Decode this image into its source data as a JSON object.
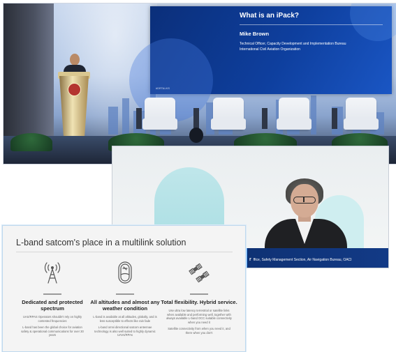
{
  "stage": {
    "screen": {
      "title": "What is an iPack?",
      "name": "Mike Brown",
      "subtitle_line1": "Technical Officer, Capacity Development and Implementation Bureau",
      "subtitle_line2": "International Civil Aviation Organization",
      "hashtag": "#DRTALKS"
    }
  },
  "video": {
    "lower_third_name_tail": "r",
    "lower_third_text": "ffice, Safety Management Section, Air Navigation Bureau, OACI"
  },
  "slide": {
    "title": "L-band satcom's place in a multilink solution",
    "columns": [
      {
        "icon": "antenna-tower-icon",
        "heading": "Dedicated and protected spectrum",
        "text": [
          "UAS/RPAS Operators shouldn't rely on highly contested frequencies",
          "L-band has been the global choice for aviation safety & operational communications for over 30 years"
        ]
      },
      {
        "icon": "aircraft-window-icon",
        "heading": "All altitudes and almost any weather condition",
        "text": [
          "L-band is available at all altitudes, globally, and is less susceptible to effects like rain fade",
          "L-band omni directional satcom antennae technology is also well suited to highly dynamic UAVs/RPAs"
        ]
      },
      {
        "icon": "satellites-icon",
        "heading": "Total flexibility. Hybrid service.",
        "text": [
          "Use ultra low latency terrestrial or satellite links when available and performing well, together with always available L-band OCC suitable connectivity when you need it",
          "Satellite connectivity from when you need it, and there when you don't"
        ]
      }
    ]
  },
  "colors": {
    "screen_blue": "#0e3f9e",
    "lower_third_blue": "#123a86",
    "slide_bg": "#f4f4f4"
  }
}
